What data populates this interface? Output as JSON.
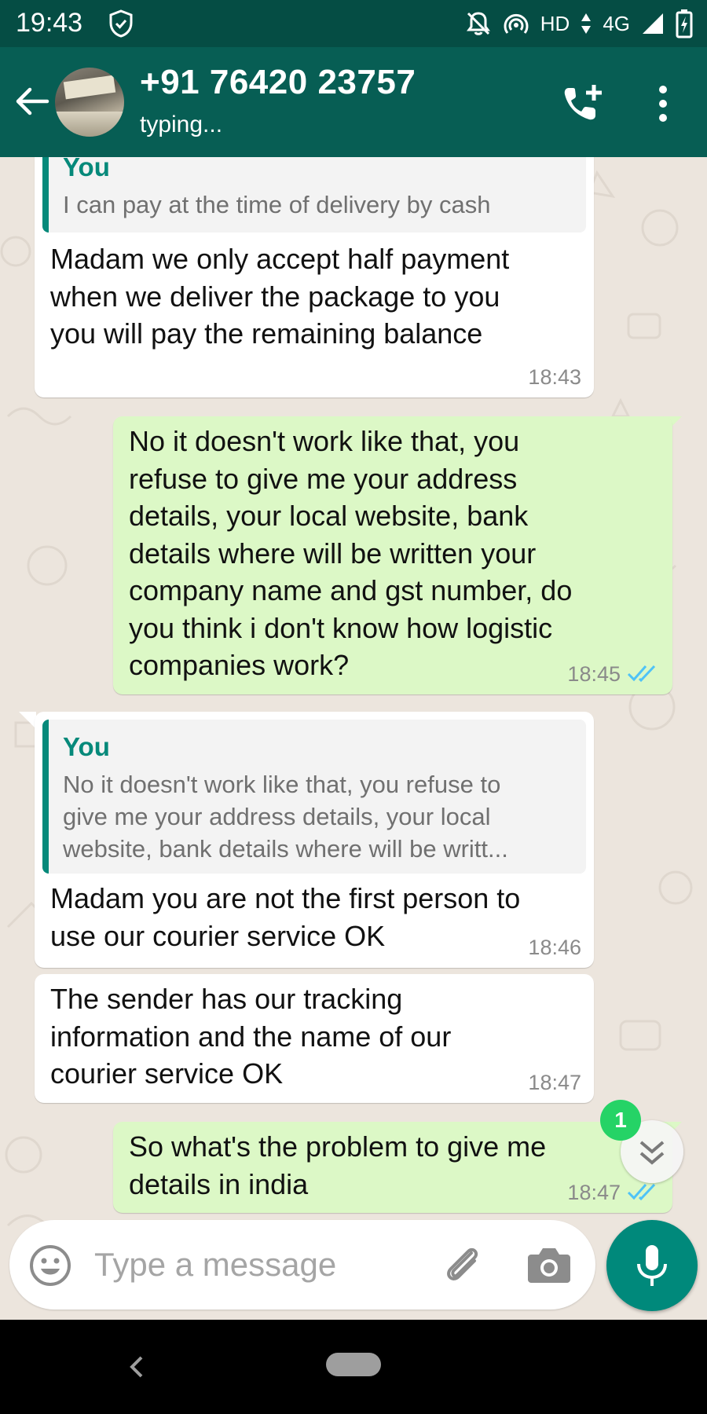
{
  "status_bar": {
    "time": "19:43",
    "network_hd": "HD",
    "network_type": "4G"
  },
  "header": {
    "contact_name": "+91 76420 23757",
    "contact_status": "typing..."
  },
  "messages": [
    {
      "direction": "incoming",
      "quote_author": "You",
      "quote_text": "I can pay at the time of delivery by cash",
      "text": "Madam we only accept half payment\nwhen we deliver the package to you\nyou will pay the remaining balance",
      "time": "18:43"
    },
    {
      "direction": "outgoing",
      "text": "No it doesn't work like that, you\nrefuse to give me your address\ndetails, your local website, bank\ndetails where will be written your\ncompany name and gst number, do\nyou think i don't know how logistic\ncompanies work?",
      "time": "18:45",
      "status": "read"
    },
    {
      "direction": "incoming",
      "quote_author": "You",
      "quote_text": "No it doesn't work like that, you refuse to\ngive me your address details, your local\nwebsite, bank details where will be writt...",
      "text": "Madam you are not the first person to\nuse our courier service OK",
      "time": "18:46"
    },
    {
      "direction": "incoming",
      "text": "The sender has our tracking\ninformation and the name of our\ncourier service OK",
      "time": "18:47"
    },
    {
      "direction": "outgoing",
      "text": "So what's the problem to give me\ndetails in india",
      "time": "18:47",
      "status": "read"
    }
  ],
  "scroll_down": {
    "unread_count": "1"
  },
  "composer": {
    "placeholder": "Type a message"
  },
  "colors": {
    "header": "#075e54",
    "status_bar": "#054d44",
    "outgoing_bubble": "#dcf8c6",
    "incoming_bubble": "#ffffff",
    "accent": "#00897b",
    "read_ticks": "#4fc3f7",
    "unread_badge": "#25d366"
  },
  "icons": [
    "shield-icon",
    "mute-icon",
    "hotspot-icon",
    "signal-icon",
    "battery-icon",
    "back-arrow-icon",
    "add-call-icon",
    "more-vert-icon",
    "emoji-icon",
    "attach-icon",
    "camera-icon",
    "mic-icon",
    "double-chevron-down-icon",
    "double-check-icon"
  ]
}
